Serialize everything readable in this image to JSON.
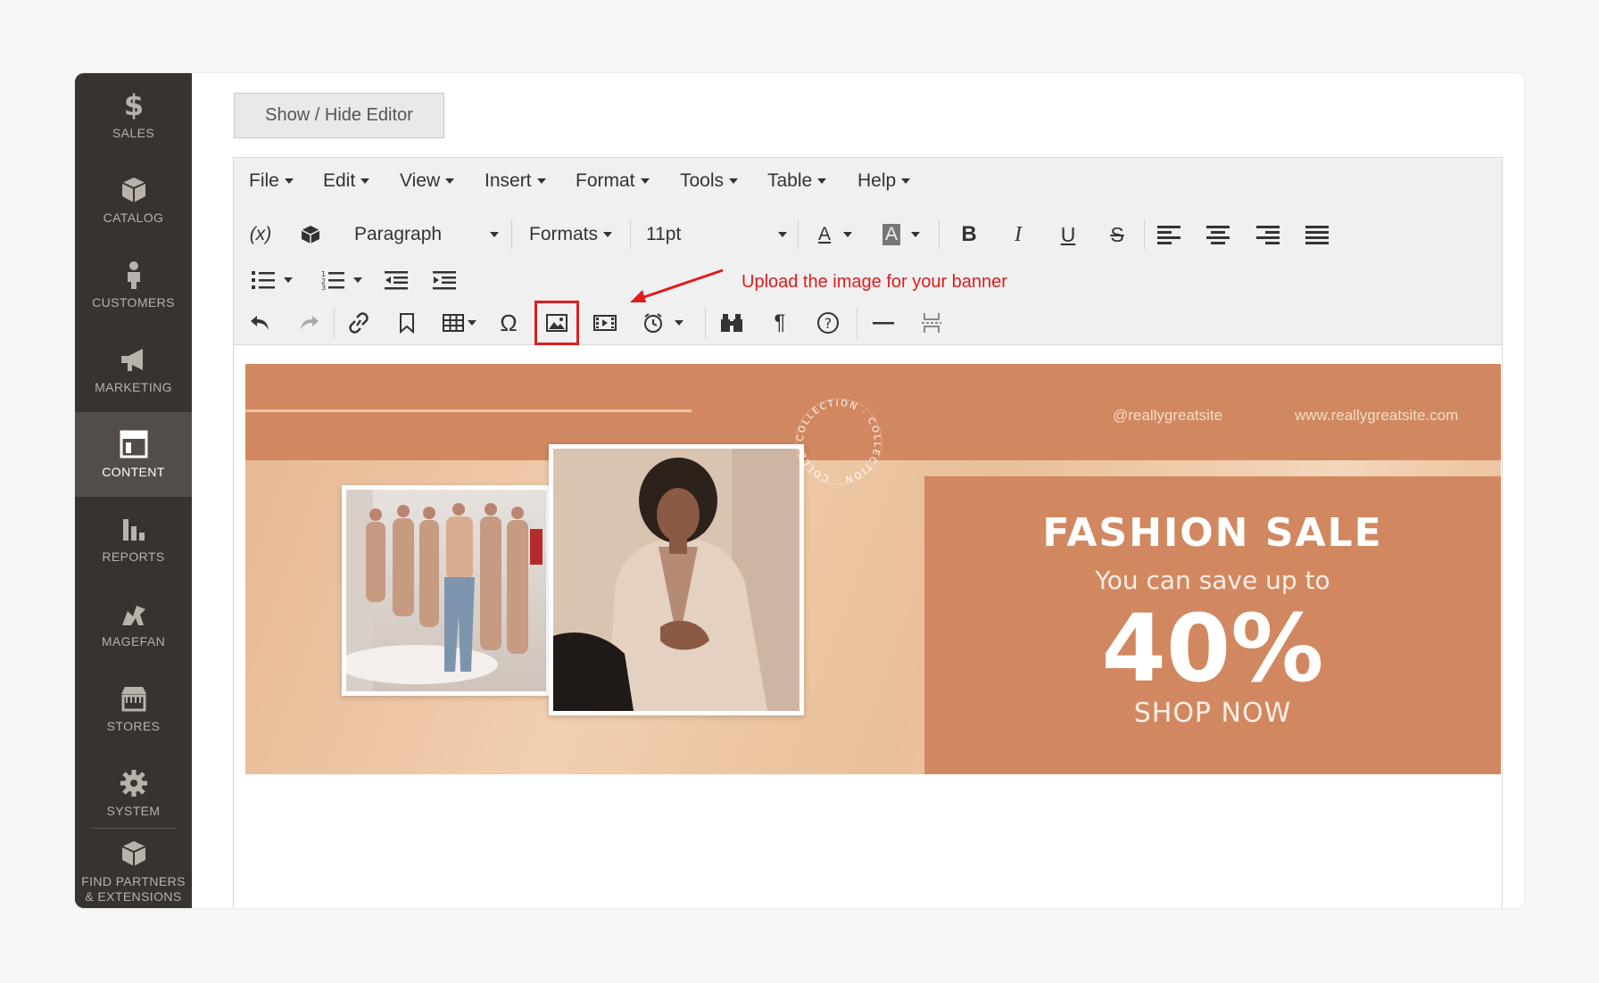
{
  "sidebar": {
    "items": [
      {
        "label": "SALES",
        "icon": "dollar-icon"
      },
      {
        "label": "CATALOG",
        "icon": "box-icon"
      },
      {
        "label": "CUSTOMERS",
        "icon": "person-icon"
      },
      {
        "label": "MARKETING",
        "icon": "megaphone-icon"
      },
      {
        "label": "CONTENT",
        "icon": "layout-icon",
        "active": true
      },
      {
        "label": "REPORTS",
        "icon": "bar-chart-icon"
      },
      {
        "label": "MAGEFAN",
        "icon": "magefan-icon"
      },
      {
        "label": "STORES",
        "icon": "store-icon"
      },
      {
        "label": "SYSTEM",
        "icon": "gear-icon"
      },
      {
        "label": "FIND PARTNERS & EXTENSIONS",
        "icon": "cube-icon"
      }
    ]
  },
  "show_hide_label": "Show / Hide Editor",
  "editor": {
    "menu": [
      "File",
      "Edit",
      "View",
      "Insert",
      "Format",
      "Tools",
      "Table",
      "Help"
    ],
    "toolbar": {
      "variable_label": "(x)",
      "block_format": "Paragraph",
      "formats_label": "Formats",
      "font_size": "11pt",
      "text_color_label": "A",
      "bg_color_label": "A",
      "bold_label": "B",
      "italic_label": "I",
      "underline_label": "U",
      "strike_label": "S",
      "omega_label": "Ω",
      "pilcrow_label": "¶",
      "help_label": "?"
    },
    "annotation": "Upload the image for your banner"
  },
  "banner": {
    "handle": "@reallygreatsite",
    "url": "www.reallygreatsite.com",
    "badge_text": "COLLECTION · COLLECTION · COLLECTION ·",
    "title": "FASHION SALE",
    "subtitle": "You can save up to",
    "percent": "40%",
    "cta": "SHOP NOW"
  },
  "colors": {
    "sidebar_bg": "#373330",
    "banner_accent": "#d18860",
    "annotation_red": "#e01b1b"
  }
}
